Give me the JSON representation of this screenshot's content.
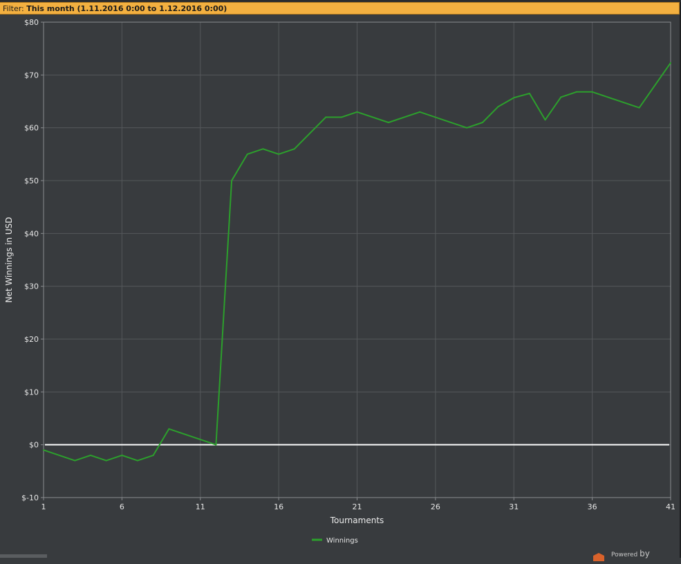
{
  "filter": {
    "prefix": "Filter:",
    "value": "This month (1.11.2016 0:00 to 1.12.2016 0:00)"
  },
  "chart_data": {
    "type": "line",
    "title": "",
    "xlabel": "Tournaments",
    "ylabel": "Net Winnings in USD",
    "xlim": [
      1,
      41
    ],
    "ylim": [
      -10,
      80
    ],
    "xticks": [
      "1",
      "6",
      "11",
      "16",
      "21",
      "26",
      "31",
      "36",
      "41"
    ],
    "yticks": [
      "$80",
      "$70",
      "$60",
      "$50",
      "$40",
      "$30",
      "$20",
      "$10",
      "$0",
      "$-10"
    ],
    "grid": true,
    "legend": "bottom-center",
    "zero_line": 0,
    "series": [
      {
        "name": "Winnings",
        "color": "#2ca02c",
        "x": [
          1,
          3,
          4,
          5,
          6,
          7,
          8,
          9,
          12,
          13,
          14,
          15,
          16,
          17,
          18,
          19,
          20,
          21,
          23,
          25,
          28,
          29,
          30,
          31,
          32,
          33,
          34,
          35,
          36,
          39,
          41
        ],
        "y": [
          -1,
          -3,
          -2,
          -3,
          -2,
          -3,
          -2,
          3,
          0,
          50,
          55,
          56,
          55,
          56,
          59,
          62,
          62,
          63,
          61,
          63,
          60,
          61,
          64,
          65.7,
          66.5,
          61.5,
          65.8,
          66.8,
          66.8,
          63.8,
          72.3
        ]
      }
    ]
  },
  "footer": {
    "powered": "Powered",
    "by": "by"
  }
}
